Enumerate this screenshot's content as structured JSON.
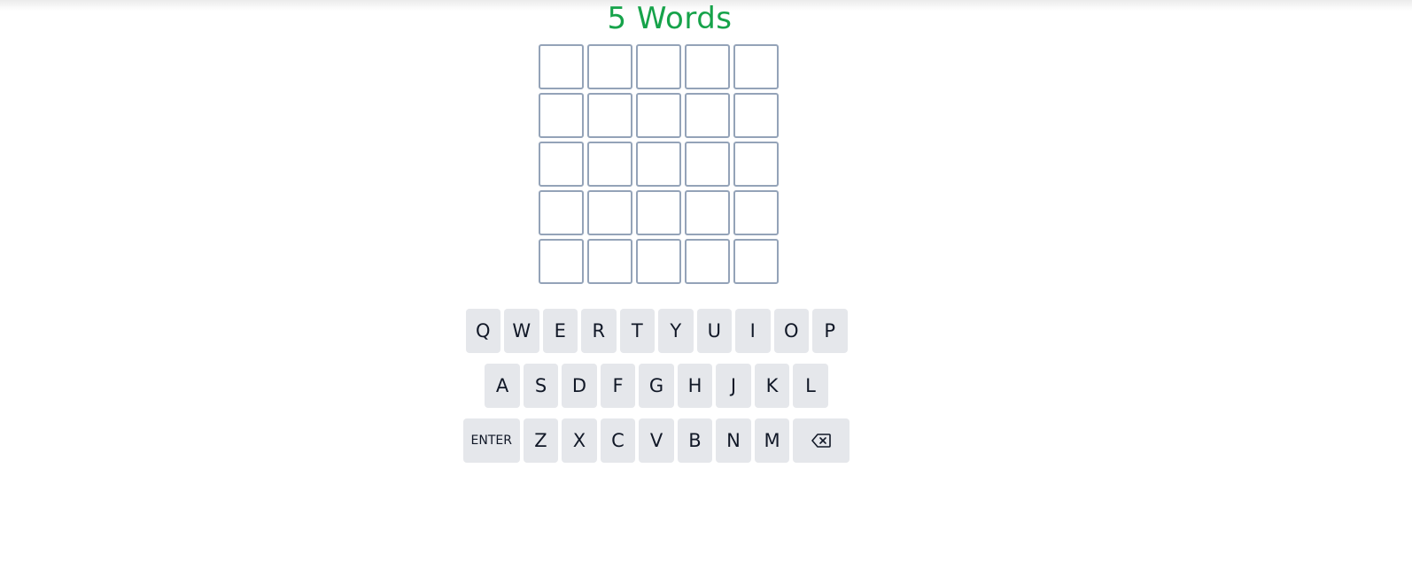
{
  "title": "5 Words",
  "board": {
    "rows": [
      [
        "",
        "",
        "",
        "",
        ""
      ],
      [
        "",
        "",
        "",
        "",
        ""
      ],
      [
        "",
        "",
        "",
        "",
        ""
      ],
      [
        "",
        "",
        "",
        "",
        ""
      ],
      [
        "",
        "",
        "",
        "",
        ""
      ]
    ]
  },
  "keyboard": {
    "row1": [
      "Q",
      "W",
      "E",
      "R",
      "T",
      "Y",
      "U",
      "I",
      "O",
      "P"
    ],
    "row2": [
      "A",
      "S",
      "D",
      "F",
      "G",
      "H",
      "J",
      "K",
      "L"
    ],
    "row3": [
      "Z",
      "X",
      "C",
      "V",
      "B",
      "N",
      "M"
    ],
    "enter_label": "ENTER",
    "backspace_icon": "backspace-icon"
  },
  "colors": {
    "title": "#16a34a",
    "cell_border": "#94a3b8",
    "key_bg": "#e5e7eb"
  }
}
